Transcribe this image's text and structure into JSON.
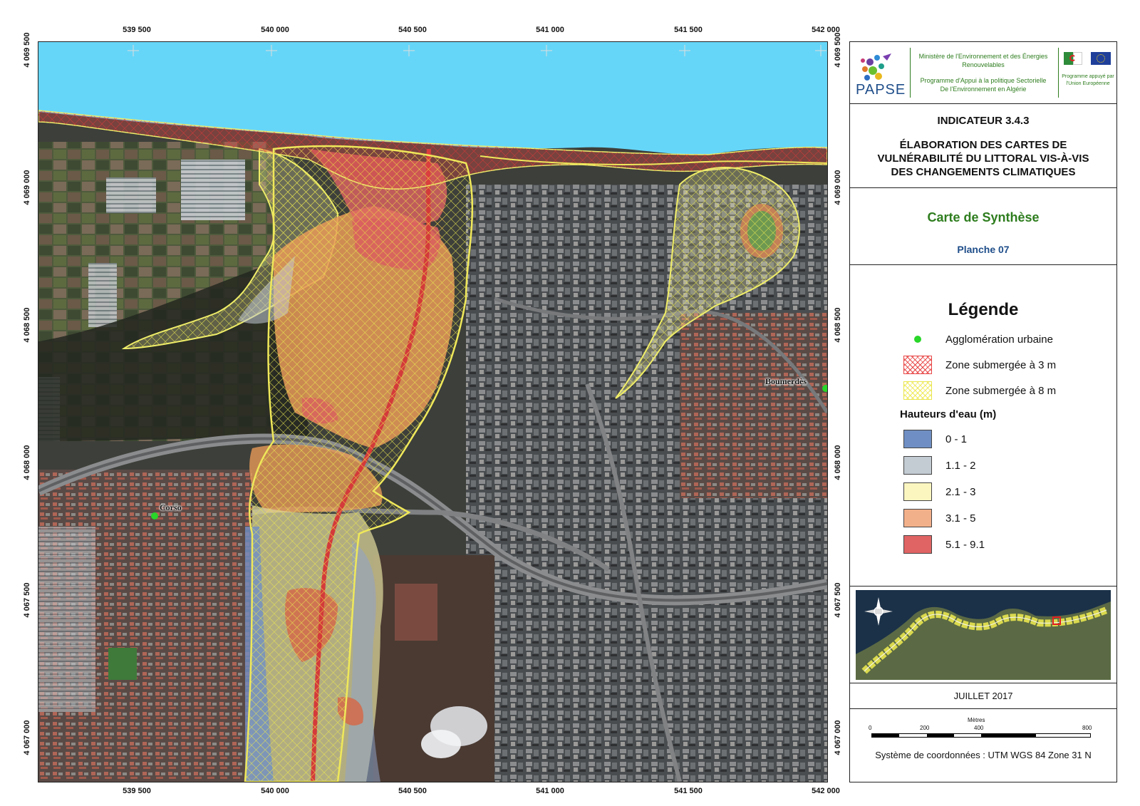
{
  "axes": {
    "x_ticks": [
      "539 500",
      "540 000",
      "540 500",
      "541 000",
      "541 500",
      "542 000"
    ],
    "y_ticks": [
      "4 069 500",
      "4 069 000",
      "4 068 500",
      "4 068 000",
      "4 067 500",
      "4 067 000"
    ]
  },
  "places": {
    "corso": "Corso",
    "boumerdes": "Boumerdès"
  },
  "header": {
    "logo_text": "PAPSE",
    "ministry_line1": "Ministère de l'Environnement et des Énergies",
    "ministry_line2": "Renouvelables",
    "programme_line1": "Programme d'Appui à la politique Sectorielle",
    "programme_line2": "De l'Environnement en Algérie",
    "eu_line1": "Programme appuyé par",
    "eu_line2": "l'Union Européenne"
  },
  "title": {
    "indicator": "INDICATEUR 3.4.3",
    "line1": "ÉLABORATION DES CARTES DE",
    "line2": "VULNÉRABILITÉ DU LITTORAL VIS-À-VIS",
    "line3": "DES CHANGEMENTS CLIMATIQUES"
  },
  "subtitle": {
    "name": "Carte de Synthèse",
    "sheet": "Planche 07"
  },
  "legend": {
    "heading": "Légende",
    "urban": "Agglomération urbaine",
    "zone3": "Zone submergée à 3 m",
    "zone8": "Zone submergée à 8 m",
    "depth_title": "Hauteurs d'eau (m)",
    "classes": [
      {
        "label": "0 - 1",
        "color": "#6f8fc4"
      },
      {
        "label": "1.1 - 2",
        "color": "#c3cbd3"
      },
      {
        "label": "2.1 - 3",
        "color": "#fbf6c0"
      },
      {
        "label": "3.1 - 5",
        "color": "#f2b08a"
      },
      {
        "label": "5.1 - 9.1",
        "color": "#e06464"
      }
    ]
  },
  "date": "JUILLET 2017",
  "scale": {
    "unit": "Mètres",
    "labels": [
      "0",
      "200",
      "400",
      "800"
    ]
  },
  "crs": "Système de coordonnées : UTM WGS 84 Zone 31 N",
  "colors": {
    "sea": "#66d6f8",
    "zone3_hatch": "#e84848",
    "zone8_hatch": "#e8e650",
    "title_green": "#2e7d1e",
    "sheet_blue": "#1f4e8a",
    "urban_dot": "#29d629"
  }
}
